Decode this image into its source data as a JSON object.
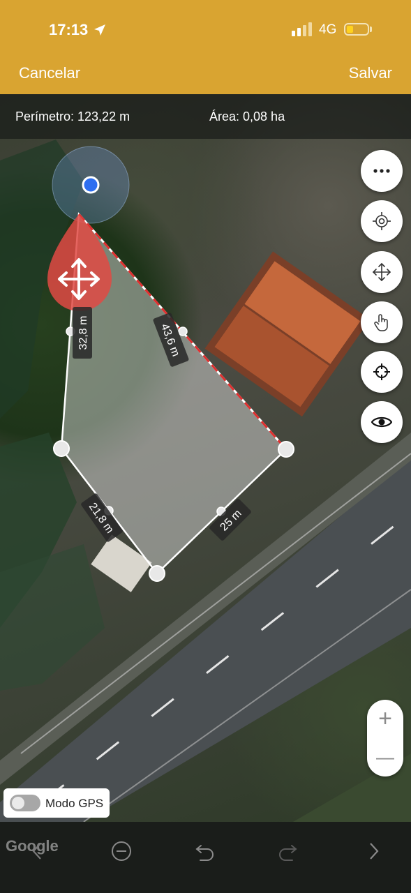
{
  "status_bar": {
    "time": "17:13",
    "network": "4G"
  },
  "header": {
    "cancel_label": "Cancelar",
    "save_label": "Salvar"
  },
  "info": {
    "perimeter_label": "Perímetro: 123,22 m",
    "area_label": "Área: 0,08 ha"
  },
  "measurements": {
    "segment_a": "32,8 m",
    "segment_b": "43,6 m",
    "segment_c": "21,8 m",
    "segment_d": "25 m"
  },
  "side_buttons": [
    "more-icon",
    "location-target-icon",
    "move-icon",
    "touch-hand-icon",
    "crosshair-icon",
    "eye-icon"
  ],
  "zoom": {
    "plus": "+",
    "minus": "—"
  },
  "gps_mode": {
    "label": "Modo GPS",
    "enabled": false
  },
  "map_attribution": "Google",
  "toolbar": [
    "back-icon",
    "remove-point-icon",
    "undo-icon",
    "redo-icon",
    "forward-icon"
  ],
  "colors": {
    "header": "#D9A431",
    "edge_highlight": "#E03030",
    "marker": "#E04A44",
    "user_dot": "#2D6EF0"
  }
}
